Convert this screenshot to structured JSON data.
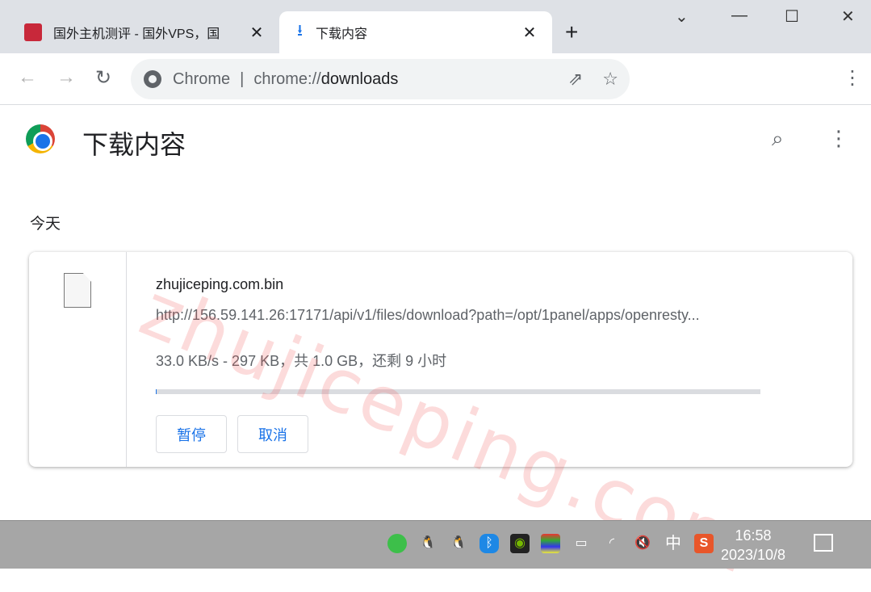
{
  "browser": {
    "tabs": [
      {
        "title": "国外主机测评 - 国外VPS，国",
        "active": false
      },
      {
        "title": "下载内容",
        "active": true
      }
    ],
    "omnibox": {
      "site": "Chrome",
      "url_prefix": "chrome://",
      "url_path": "downloads"
    }
  },
  "page": {
    "title": "下载内容",
    "section": "今天"
  },
  "download": {
    "filename": "zhujiceping.com.bin",
    "url": "http://156.59.141.26:17171/api/v1/files/download?path=/opt/1panel/apps/openresty...",
    "status": "33.0 KB/s - 297 KB，共 1.0 GB，还剩 9 小时",
    "progress_fraction": 0.0003,
    "pause_label": "暂停",
    "cancel_label": "取消"
  },
  "watermark": "zhujiceping.com",
  "taskbar": {
    "ime": "中",
    "time": "16:58",
    "date": "2023/10/8"
  },
  "colors": {
    "accent": "#1a73e8",
    "tabstrip": "#dee1e6",
    "taskbar": "#a6a6a6"
  }
}
